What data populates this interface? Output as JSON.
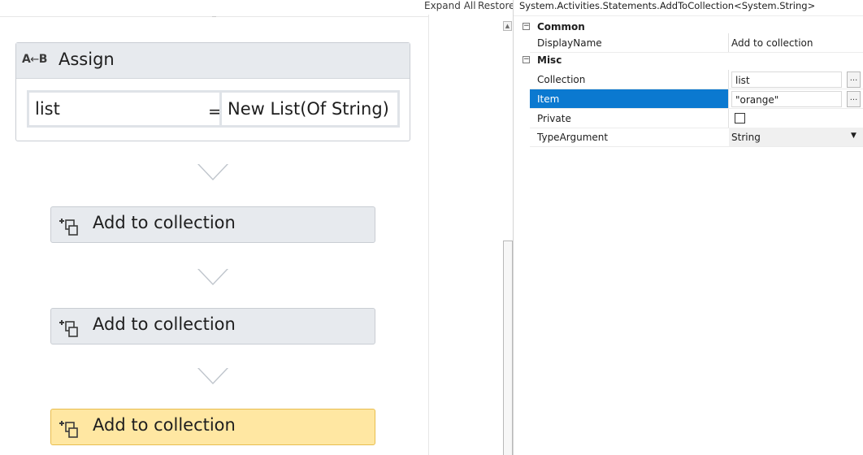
{
  "designer": {
    "expand_all": "Expand All",
    "restore": "Restore",
    "assign": {
      "icon_text": "A",
      "icon_arrow": "←",
      "icon_text2": "B",
      "title": "Assign",
      "left_expr": "list",
      "equals": "=",
      "right_expr": "New List(Of String)"
    },
    "activities": [
      {
        "label": "Add to collection",
        "selected": false
      },
      {
        "label": "Add to collection",
        "selected": false
      },
      {
        "label": "Add to collection",
        "selected": true
      }
    ]
  },
  "properties": {
    "title": "System.Activities.Statements.AddToCollection<System.String>",
    "categories": [
      {
        "toggle": "⊟",
        "name": "Common"
      },
      {
        "toggle": "⊟",
        "name": "Misc"
      }
    ],
    "rows": {
      "display_name": {
        "name": "DisplayName",
        "value": "Add to collection"
      },
      "collection": {
        "name": "Collection",
        "value": "list",
        "button": "..."
      },
      "item": {
        "name": "Item",
        "value": "\"orange\"",
        "button": "..."
      },
      "private": {
        "name": "Private",
        "checked": false
      },
      "type_argument": {
        "name": "TypeArgument",
        "value": "String",
        "caret": "▼"
      }
    }
  },
  "colors": {
    "selected_row": "#0b79d0",
    "selected_activity": "#ffe7a2",
    "activity_bg": "#e7eaee"
  },
  "icons": {
    "add_to_collection": "add-to-collection-icon",
    "assign": "assign-icon",
    "scroll_up": "scroll-up-arrow-icon"
  }
}
